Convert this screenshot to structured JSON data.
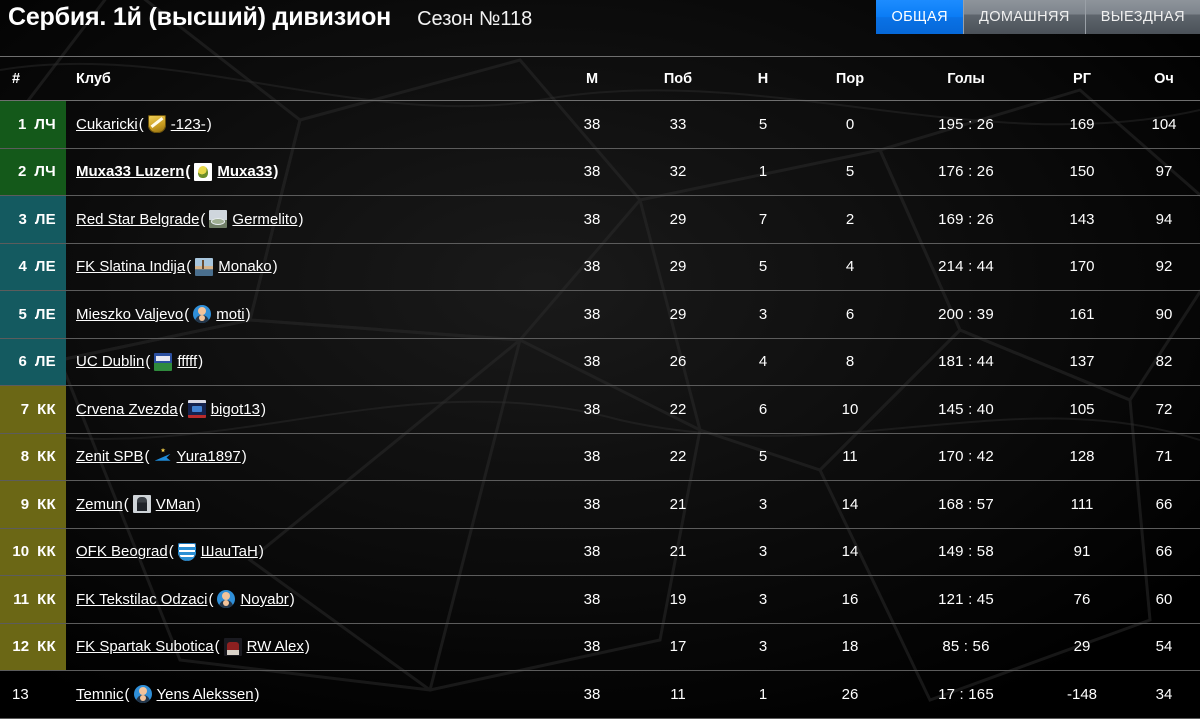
{
  "header": {
    "league_title": "Сербия. 1й (высший) дивизион",
    "season": "Сезон №118"
  },
  "tabs": [
    {
      "label": "ОБЩАЯ",
      "active": true
    },
    {
      "label": "ДОМАШНЯЯ",
      "active": false
    },
    {
      "label": "ВЫЕЗДНАЯ",
      "active": false
    }
  ],
  "colors": {
    "accent_blue": "#0a7cf5",
    "zone_lch": "#14591a",
    "zone_le": "#145a60",
    "zone_kk": "#6b6715",
    "background": "#050505",
    "row_border": "#5c5c5c"
  },
  "table": {
    "columns": [
      {
        "key": "rank",
        "label": "#"
      },
      {
        "key": "club",
        "label": "Клуб"
      },
      {
        "key": "m",
        "label": "М"
      },
      {
        "key": "w",
        "label": "Поб"
      },
      {
        "key": "d",
        "label": "Н"
      },
      {
        "key": "l",
        "label": "Пор"
      },
      {
        "key": "goals",
        "label": "Голы"
      },
      {
        "key": "gd",
        "label": "РГ"
      },
      {
        "key": "pts",
        "label": "Оч"
      }
    ],
    "rows": [
      {
        "rank": "1",
        "zone": "ЛЧ",
        "zone_key": "lch",
        "club": "Cukaricki",
        "manager": "-123-",
        "icon": "shield-icon",
        "own": false,
        "m": "38",
        "w": "33",
        "d": "5",
        "l": "0",
        "goals": "195 : 26",
        "gd": "169",
        "pts": "104"
      },
      {
        "rank": "2",
        "zone": "ЛЧ",
        "zone_key": "lch",
        "club": "Muxa33 Luzern",
        "manager": "Muxa33",
        "icon": "bee-icon",
        "own": true,
        "m": "38",
        "w": "32",
        "d": "1",
        "l": "5",
        "goals": "176 : 26",
        "gd": "150",
        "pts": "97"
      },
      {
        "rank": "3",
        "zone": "ЛЕ",
        "zone_key": "le",
        "club": "Red Star Belgrade",
        "manager": "Germelito",
        "icon": "stadium-icon",
        "own": false,
        "m": "38",
        "w": "29",
        "d": "7",
        "l": "2",
        "goals": "169 : 26",
        "gd": "143",
        "pts": "94"
      },
      {
        "rank": "4",
        "zone": "ЛЕ",
        "zone_key": "le",
        "club": "FK Slatina Indija",
        "manager": "Monako",
        "icon": "city-icon",
        "own": false,
        "m": "38",
        "w": "29",
        "d": "5",
        "l": "4",
        "goals": "214 : 44",
        "gd": "170",
        "pts": "92"
      },
      {
        "rank": "5",
        "zone": "ЛЕ",
        "zone_key": "le",
        "club": "Mieszko Valjevo",
        "manager": "moti",
        "icon": "person-icon",
        "own": false,
        "m": "38",
        "w": "29",
        "d": "3",
        "l": "6",
        "goals": "200 : 39",
        "gd": "161",
        "pts": "90"
      },
      {
        "rank": "6",
        "zone": "ЛЕ",
        "zone_key": "le",
        "club": "UC Dublin",
        "manager": "fffff",
        "icon": "ucd-crest-icon",
        "own": false,
        "m": "38",
        "w": "26",
        "d": "4",
        "l": "8",
        "goals": "181 : 44",
        "gd": "137",
        "pts": "82"
      },
      {
        "rank": "7",
        "zone": "КК",
        "zone_key": "kk",
        "club": "Crvena Zvezda",
        "manager": "bigot13",
        "icon": "zvezda-icon",
        "own": false,
        "m": "38",
        "w": "22",
        "d": "6",
        "l": "10",
        "goals": "145 : 40",
        "gd": "105",
        "pts": "72"
      },
      {
        "rank": "8",
        "zone": "КК",
        "zone_key": "kk",
        "club": "Zenit SPB",
        "manager": "Yura1897",
        "icon": "zenit-icon",
        "own": false,
        "m": "38",
        "w": "22",
        "d": "5",
        "l": "11",
        "goals": "170 : 42",
        "gd": "128",
        "pts": "71"
      },
      {
        "rank": "9",
        "zone": "КК",
        "zone_key": "kk",
        "club": "Zemun",
        "manager": "VMan",
        "icon": "portrait-icon",
        "own": false,
        "m": "38",
        "w": "21",
        "d": "3",
        "l": "14",
        "goals": "168 : 57",
        "gd": "111",
        "pts": "66"
      },
      {
        "rank": "10",
        "zone": "КК",
        "zone_key": "kk",
        "club": "OFK Beograd",
        "manager": "ШauTaH",
        "icon": "ofk-crest-icon",
        "own": false,
        "m": "38",
        "w": "21",
        "d": "3",
        "l": "14",
        "goals": "149 : 58",
        "gd": "91",
        "pts": "66"
      },
      {
        "rank": "11",
        "zone": "КК",
        "zone_key": "kk",
        "club": "FK Tekstilac Odzaci",
        "manager": "Noyabr",
        "icon": "person-icon",
        "own": false,
        "m": "38",
        "w": "19",
        "d": "3",
        "l": "16",
        "goals": "121 : 45",
        "gd": "76",
        "pts": "60"
      },
      {
        "rank": "12",
        "zone": "КК",
        "zone_key": "kk",
        "club": "FK Spartak Subotica",
        "manager": "RW Alex",
        "icon": "spartak-icon",
        "own": false,
        "m": "38",
        "w": "17",
        "d": "3",
        "l": "18",
        "goals": "85 : 56",
        "gd": "29",
        "pts": "54"
      },
      {
        "rank": "13",
        "zone": "",
        "zone_key": "none",
        "club": "Temnic",
        "manager": "Yens Alekssen",
        "icon": "person-icon",
        "own": false,
        "m": "38",
        "w": "11",
        "d": "1",
        "l": "26",
        "goals": "17 : 165",
        "gd": "-148",
        "pts": "34"
      }
    ]
  }
}
